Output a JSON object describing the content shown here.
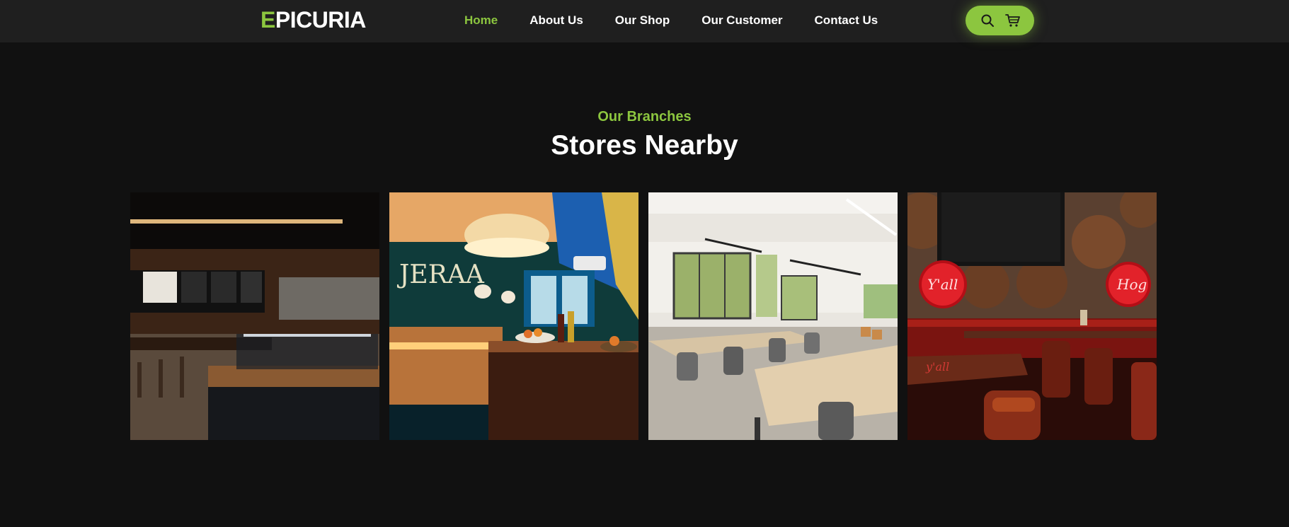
{
  "brand": {
    "first_letter": "E",
    "rest": "PICURIA",
    "accent_color": "#8cc63f"
  },
  "nav": {
    "items": [
      {
        "label": "Home",
        "active": true
      },
      {
        "label": "About Us",
        "active": false
      },
      {
        "label": "Our Shop",
        "active": false
      },
      {
        "label": "Our Customer",
        "active": false
      },
      {
        "label": "Contact Us",
        "active": false
      }
    ]
  },
  "actions": {
    "icons": [
      "search-icon",
      "cart-icon"
    ]
  },
  "section": {
    "subtitle": "Our Branches",
    "title": "Stores Nearby"
  },
  "stores": [
    {
      "image": "cafe-counter-interior"
    },
    {
      "image": "teal-bar-interior"
    },
    {
      "image": "bright-cafeteria-interior"
    },
    {
      "image": "red-neon-lounge-interior"
    }
  ],
  "colors": {
    "background": "#111111",
    "navbar": "#1f1f1f",
    "accent": "#8cc63f",
    "text": "#ffffff"
  }
}
